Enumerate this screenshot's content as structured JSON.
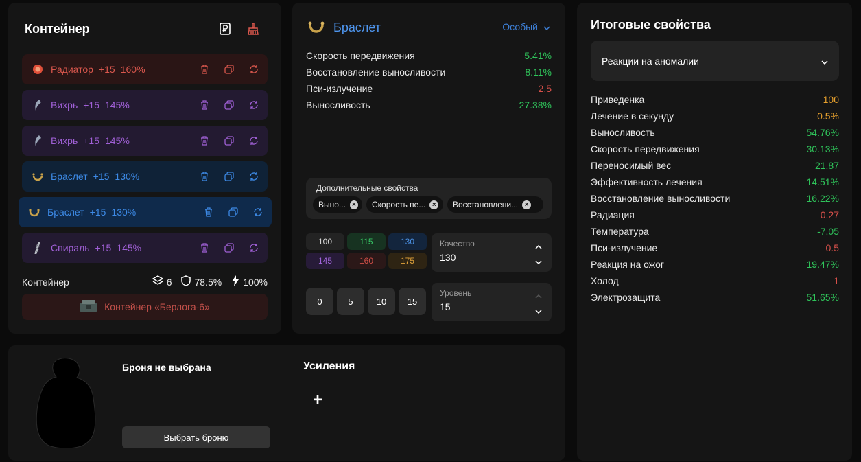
{
  "container": {
    "title": "Контейнер",
    "artifacts": [
      {
        "name": "Радиатор",
        "level": "+15",
        "quality": "160%",
        "color": "#d9574d"
      },
      {
        "name": "Вихрь",
        "level": "+15",
        "quality": "145%",
        "color": "#a060d6"
      },
      {
        "name": "Вихрь",
        "level": "+15",
        "quality": "145%",
        "color": "#a060d6"
      },
      {
        "name": "Браслет",
        "level": "+15",
        "quality": "130%",
        "color": "#3d8ae6"
      },
      {
        "name": "Браслет",
        "level": "+15",
        "quality": "130%",
        "color": "#3d8ae6"
      },
      {
        "name": "Спираль",
        "level": "+15",
        "quality": "145%",
        "color": "#a060d6"
      }
    ],
    "footer": {
      "label": "Контейнер",
      "slots": "6",
      "protection": "78.5%",
      "efficiency": "100%"
    },
    "selected_container": "Контейнер «Берлога-6»"
  },
  "bracelet": {
    "title": "Браслет",
    "rarity": "Особый",
    "properties": [
      {
        "name": "Скорость передвижения",
        "value": "5.41%"
      },
      {
        "name": "Восстановление выносливости",
        "value": "8.11%"
      },
      {
        "name": "Пси-излучение",
        "value": "2.5"
      },
      {
        "name": "Выносливость",
        "value": "27.38%"
      }
    ],
    "extra_label": "Дополнительные свойства",
    "extra_chips": [
      "Выно...",
      "Скорость пе...",
      "Восстановлени..."
    ],
    "quality_presets": [
      "100",
      "115",
      "130",
      "145",
      "160",
      "175"
    ],
    "quality_label": "Качество",
    "quality_value": "130",
    "level_presets": [
      "0",
      "5",
      "10",
      "15"
    ],
    "level_label": "Уровень",
    "level_value": "15"
  },
  "armor": {
    "title": "Броня не выбрана",
    "button": "Выбрать броню",
    "boosts_title": "Усиления",
    "add_symbol": "+"
  },
  "totals": {
    "title": "Итоговые свойства",
    "select_value": "Реакции на аномалии",
    "rows": [
      {
        "name": "Приведенка",
        "value": "100"
      },
      {
        "name": "Лечение в секунду",
        "value": "0.5%"
      },
      {
        "name": "Выносливость",
        "value": "54.76%"
      },
      {
        "name": "Скорость передвижения",
        "value": "30.13%"
      },
      {
        "name": "Переносимый вес",
        "value": "21.87"
      },
      {
        "name": "Эффективность лечения",
        "value": "14.51%"
      },
      {
        "name": "Восстановление выносливости",
        "value": "16.22%"
      },
      {
        "name": "Радиация",
        "value": "0.27"
      },
      {
        "name": "Температура",
        "value": "-7.05"
      },
      {
        "name": "Пси-излучение",
        "value": "0.5"
      },
      {
        "name": "Реакция на ожог",
        "value": "19.47%"
      },
      {
        "name": "Холод",
        "value": "1"
      },
      {
        "name": "Электрозащита",
        "value": "51.65%"
      }
    ]
  },
  "colors": {
    "positive": "#2fc35a",
    "negative": "#d6504a",
    "neutral": "#e8a12d",
    "accent_blue": "#4e95ee"
  }
}
